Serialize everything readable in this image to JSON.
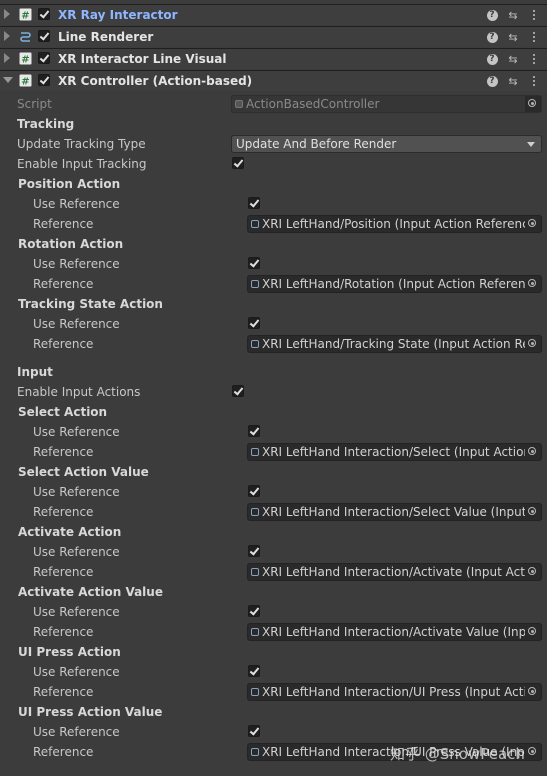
{
  "components": [
    {
      "title": "XR Ray Interactor",
      "icon": "script-hash-icon",
      "link": true
    },
    {
      "title": "Line Renderer",
      "icon": "line-renderer-icon",
      "link": false
    },
    {
      "title": "XR Interactor Line Visual",
      "icon": "script-hash-icon",
      "link": false
    },
    {
      "title": "XR Controller (Action-based)",
      "icon": "script-hash-icon",
      "link": false
    }
  ],
  "script": {
    "label": "Script",
    "value": "ActionBasedController"
  },
  "tracking": {
    "header": "Tracking",
    "update_type_label": "Update Tracking Type",
    "update_type_value": "Update And Before Render",
    "enable_label": "Enable Input Tracking",
    "position_action": "Position Action",
    "rotation_action": "Rotation Action",
    "tracking_state_action": "Tracking State Action"
  },
  "common": {
    "use_reference": "Use Reference",
    "reference": "Reference"
  },
  "refs": {
    "position": "XRI LeftHand/Position (Input Action Reference)",
    "rotation": "XRI LeftHand/Rotation (Input Action Reference)",
    "tracking_state": "XRI LeftHand/Tracking State (Input Action Reference)",
    "select": "XRI LeftHand Interaction/Select (Input Action Reference)",
    "select_value": "XRI LeftHand Interaction/Select Value (Input Action Reference)",
    "activate": "XRI LeftHand Interaction/Activate (Input Action Reference)",
    "activate_value": "XRI LeftHand Interaction/Activate Value (Input Action Reference)",
    "ui_press": "XRI LeftHand Interaction/UI Press (Input Action Reference)",
    "ui_press_value": "XRI LeftHand Interaction/UI Press Value (Input Action Reference)"
  },
  "input": {
    "header": "Input",
    "enable_label": "Enable Input Actions",
    "select_action": "Select Action",
    "select_action_value": "Select Action Value",
    "activate_action": "Activate Action",
    "activate_action_value": "Activate Action Value",
    "ui_press_action": "UI Press Action",
    "ui_press_action_value": "UI Press Action Value"
  },
  "watermark": "知乎 @SnowPeach"
}
